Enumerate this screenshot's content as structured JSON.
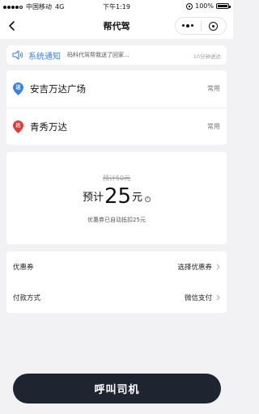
{
  "status_bar": {
    "carrier": "中国移动",
    "network": "4G",
    "time": "下午1:19",
    "battery": "100%"
  },
  "nav": {
    "title": "帮代驾",
    "back_icon": "back-arrow-icon",
    "more_icon": "more-dots-icon",
    "close_icon": "capsule-close-icon"
  },
  "notice": {
    "title": "系统通知",
    "message": "码科代驾帮我送了回家...",
    "time": "10分钟送达",
    "icon": "speaker-icon",
    "color": "#3b82e6"
  },
  "route": {
    "start": {
      "pin_label": "送",
      "name": "安吉万达广场",
      "tag": "常用",
      "color": "#3b82e6"
    },
    "end": {
      "pin_label": "达",
      "name": "青秀万达",
      "tag": "常用",
      "color": "#e53935"
    }
  },
  "fare": {
    "original": "预计50元",
    "prefix": "预计",
    "amount": "25",
    "unit": "元",
    "coupon_note": "优惠券已自动抵扣25元"
  },
  "options": {
    "coupon": {
      "label": "优惠券",
      "value": "选择优惠券"
    },
    "payment": {
      "label": "付款方式",
      "value": "微信支付"
    }
  },
  "call_button": {
    "label": "呼叫司机",
    "color": "#1f2431"
  }
}
